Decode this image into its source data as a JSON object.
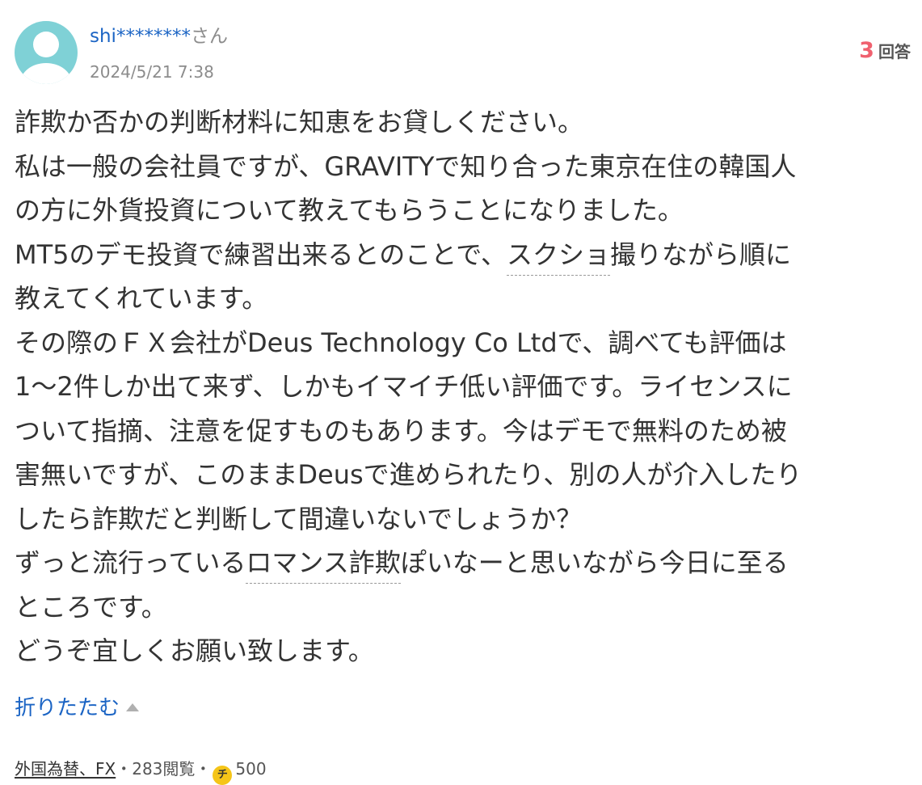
{
  "user": {
    "name": "shi********",
    "suffix": "さん",
    "date": "2024/5/21 7:38"
  },
  "answers": {
    "count": "3",
    "label": "回答"
  },
  "question": {
    "l1": "詐欺か否かの判断材料に知恵をお貸しください。",
    "l2": "私は一般の会社員ですが、GRAVITYで知り合った東京在住の韓国人",
    "l3": "の方に外貨投資について教えてもらうことになりました。",
    "l4_pre": "MT5のデモ投資で練習出来るとのことで、",
    "l4_kw": "スクショ",
    "l4_post": "撮りながら順に",
    "l5": "教えてくれています。",
    "l6": "その際のＦＸ会社がDeus Technology Co Ltdで、調べても評価は",
    "l7": "1～2件しか出て来ず、しかもイマイチ低い評価です。ライセンスに",
    "l8": "ついて指摘、注意を促すものもあります。今はデモで無料のため被",
    "l9": "害無いですが、このままDeusで進められたり、別の人が介入したり",
    "l10": "したら詐欺だと判断して間違いないでしょうか？",
    "l11_pre": "ずっと流行っている",
    "l11_kw": "ロマンス詐欺",
    "l11_post": "ぽいなーと思いながら今日に至る",
    "l12": "ところです。",
    "l13": "どうぞ宜しくお願い致します。"
  },
  "fold": {
    "label": "折りたたむ",
    "icon": "caret-up-icon"
  },
  "meta": {
    "category": "外国為替、FX",
    "sep1": "・",
    "views": "283閲覧",
    "sep2": "・",
    "coin_glyph": "チ",
    "coin_amount": "500",
    "coin_color": "#f5c518"
  },
  "colors": {
    "link": "#1b64c4",
    "accent": "#f0616f",
    "avatar": "#7fd1d6"
  }
}
